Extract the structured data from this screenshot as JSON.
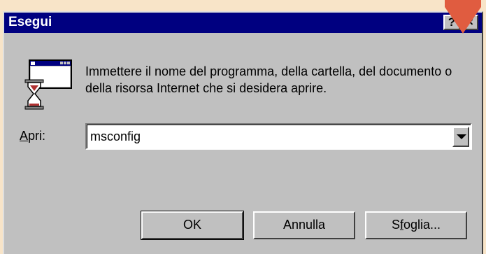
{
  "window": {
    "title": "Esegui",
    "help_label": "?",
    "close_label": "×"
  },
  "icons": {
    "program": "run-program-hourglass-icon",
    "pointer": "annotation-arrow-icon"
  },
  "colors": {
    "titlebar": "#000080",
    "face": "#c0c0c0",
    "annotation": "#e05c40",
    "page_background": "#f8e4c8"
  },
  "dialog": {
    "description": "Immettere il nome del programma, della cartella, del documento o della risorsa Internet che si desidera aprire.",
    "open_label_mnemonic": "A",
    "open_label_rest": "pri:",
    "open_value": "msconfig"
  },
  "buttons": {
    "ok": "OK",
    "cancel": "Annulla",
    "browse_pre": "S",
    "browse_mnemonic": "f",
    "browse_post": "oglia..."
  }
}
